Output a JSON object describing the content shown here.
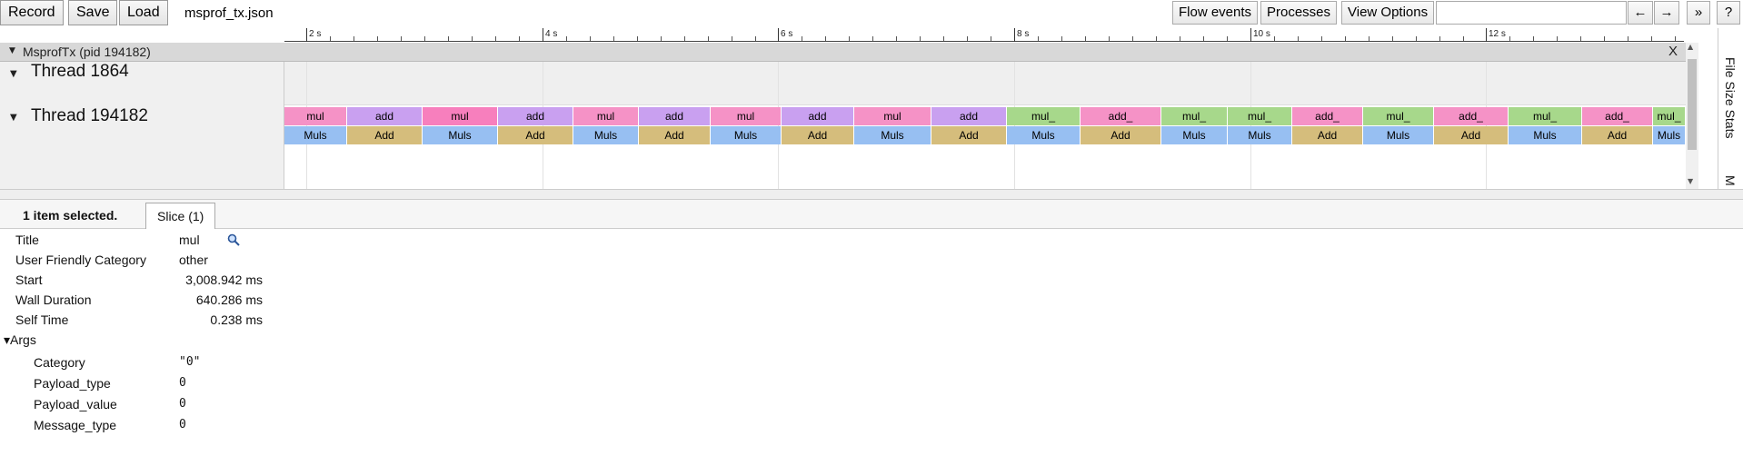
{
  "toolbar": {
    "record_label": "Record",
    "save_label": "Save",
    "load_label": "Load",
    "filename": "msprof_tx.json",
    "flow_events_label": "Flow events",
    "processes_label": "Processes",
    "view_options_label": "View Options",
    "search_value": "",
    "nav_prev": "←",
    "nav_next": "→",
    "more": "»",
    "help": "?"
  },
  "ruler": {
    "ticks": [
      "2 s",
      "4 s",
      "6 s",
      "8 s",
      "10 s",
      "12 s"
    ]
  },
  "process": {
    "title": "MsprofTx (pid 194182)",
    "close_label": "X"
  },
  "threads": [
    {
      "label": "Thread 1864"
    },
    {
      "label": "Thread 194182"
    }
  ],
  "slices_top": [
    {
      "label": "mul",
      "color": "#f592c6"
    },
    {
      "label": "add",
      "color": "#c9a0f0"
    },
    {
      "label": "mul",
      "color": "#f77fbd"
    },
    {
      "label": "add",
      "color": "#c9a0f0"
    },
    {
      "label": "mul",
      "color": "#f592c6"
    },
    {
      "label": "add",
      "color": "#c9a0f0"
    },
    {
      "label": "mul",
      "color": "#f592c6"
    },
    {
      "label": "add",
      "color": "#c9a0f0"
    },
    {
      "label": "mul",
      "color": "#f592c6"
    },
    {
      "label": "add",
      "color": "#c9a0f0"
    },
    {
      "label": "mul_",
      "color": "#a7d88b"
    },
    {
      "label": "add_",
      "color": "#f592c6"
    },
    {
      "label": "mul_",
      "color": "#a7d88b"
    },
    {
      "label": "mul_",
      "color": "#a7d88b"
    },
    {
      "label": "add_",
      "color": "#f592c6"
    },
    {
      "label": "mul_",
      "color": "#a7d88b"
    },
    {
      "label": "add_",
      "color": "#f592c6"
    },
    {
      "label": "mul_",
      "color": "#a7d88b"
    },
    {
      "label": "add_",
      "color": "#f592c6"
    },
    {
      "label": "mul_",
      "color": "#a7d88b"
    }
  ],
  "slices_bottom": [
    {
      "label": "Muls",
      "color": "#97bff2"
    },
    {
      "label": "Add",
      "color": "#d5bd7c"
    },
    {
      "label": "Muls",
      "color": "#97bff2"
    },
    {
      "label": "Add",
      "color": "#d5bd7c"
    },
    {
      "label": "Muls",
      "color": "#97bff2"
    },
    {
      "label": "Add",
      "color": "#d5bd7c"
    },
    {
      "label": "Muls",
      "color": "#97bff2"
    },
    {
      "label": "Add",
      "color": "#d5bd7c"
    },
    {
      "label": "Muls",
      "color": "#97bff2"
    },
    {
      "label": "Add",
      "color": "#d5bd7c"
    },
    {
      "label": "Muls",
      "color": "#97bff2"
    },
    {
      "label": "Add",
      "color": "#d5bd7c"
    },
    {
      "label": "Muls",
      "color": "#97bff2"
    },
    {
      "label": "Muls",
      "color": "#97bff2"
    },
    {
      "label": "Add",
      "color": "#d5bd7c"
    },
    {
      "label": "Muls",
      "color": "#97bff2"
    },
    {
      "label": "Add",
      "color": "#d5bd7c"
    },
    {
      "label": "Muls",
      "color": "#97bff2"
    },
    {
      "label": "Add",
      "color": "#d5bd7c"
    },
    {
      "label": "Muls",
      "color": "#97bff2"
    }
  ],
  "side_tabs": [
    "File Size Stats",
    "M"
  ],
  "analysis": {
    "selected_count": "1 item selected.",
    "slice_tab": "Slice (1)"
  },
  "details": {
    "title_label": "Title",
    "title_value": "mul",
    "category_label": "User Friendly Category",
    "category_value": "other",
    "start_label": "Start",
    "start_value": "3,008.942 ms",
    "wall_label": "Wall Duration",
    "wall_value": "640.286 ms",
    "self_label": "Self Time",
    "self_value": "0.238 ms",
    "args_label": "▾Args",
    "args": [
      {
        "label": "Category",
        "value": "\"0\""
      },
      {
        "label": "Payload_type",
        "value": "0"
      },
      {
        "label": "Payload_value",
        "value": "0"
      },
      {
        "label": "Message_type",
        "value": "0"
      }
    ]
  }
}
